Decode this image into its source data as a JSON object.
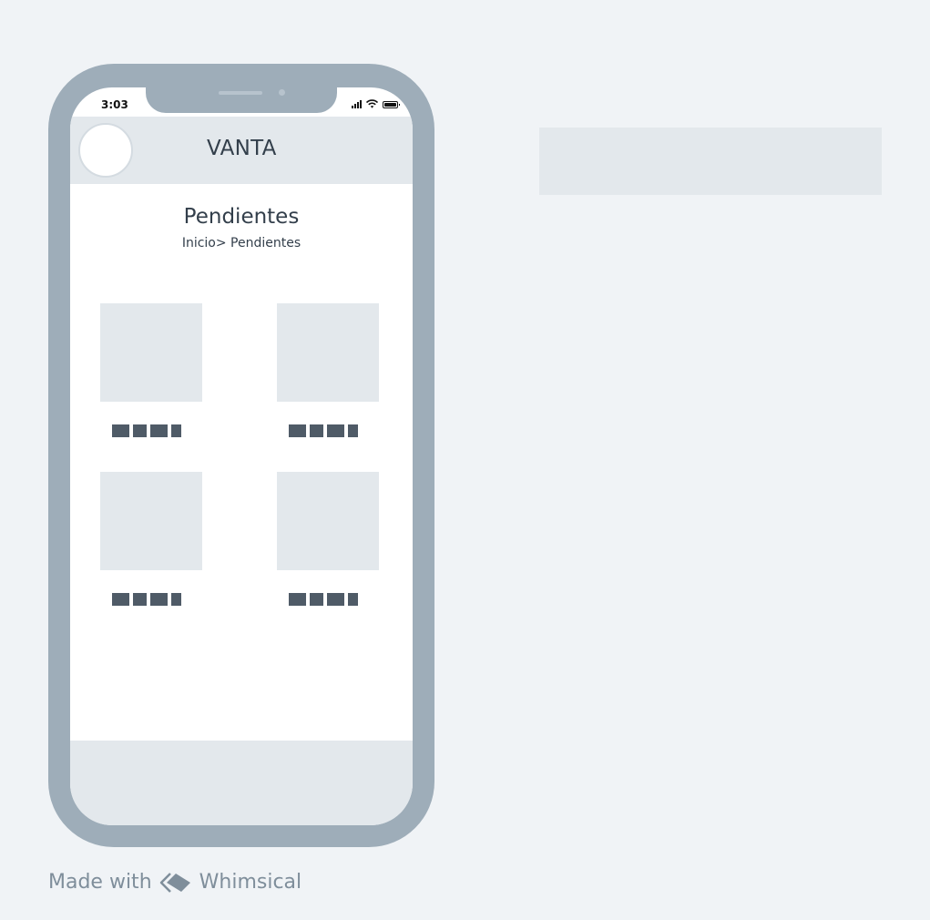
{
  "status_bar": {
    "time": "3:03"
  },
  "header": {
    "brand": "VANTA"
  },
  "page": {
    "title": "Pendientes",
    "breadcrumb": "Inicio> Pendientes"
  },
  "watermark": {
    "prefix": "Made with",
    "brand": "Whimsical"
  },
  "colors": {
    "background": "#f0f3f6",
    "phone_frame": "#9eadb9",
    "placeholder": "#e3e8ec",
    "text": "#333f4b",
    "label_blocks": "#4f5b67"
  },
  "icons": [
    "signal-icon",
    "wifi-icon",
    "battery-icon",
    "whimsical-logo-icon"
  ]
}
